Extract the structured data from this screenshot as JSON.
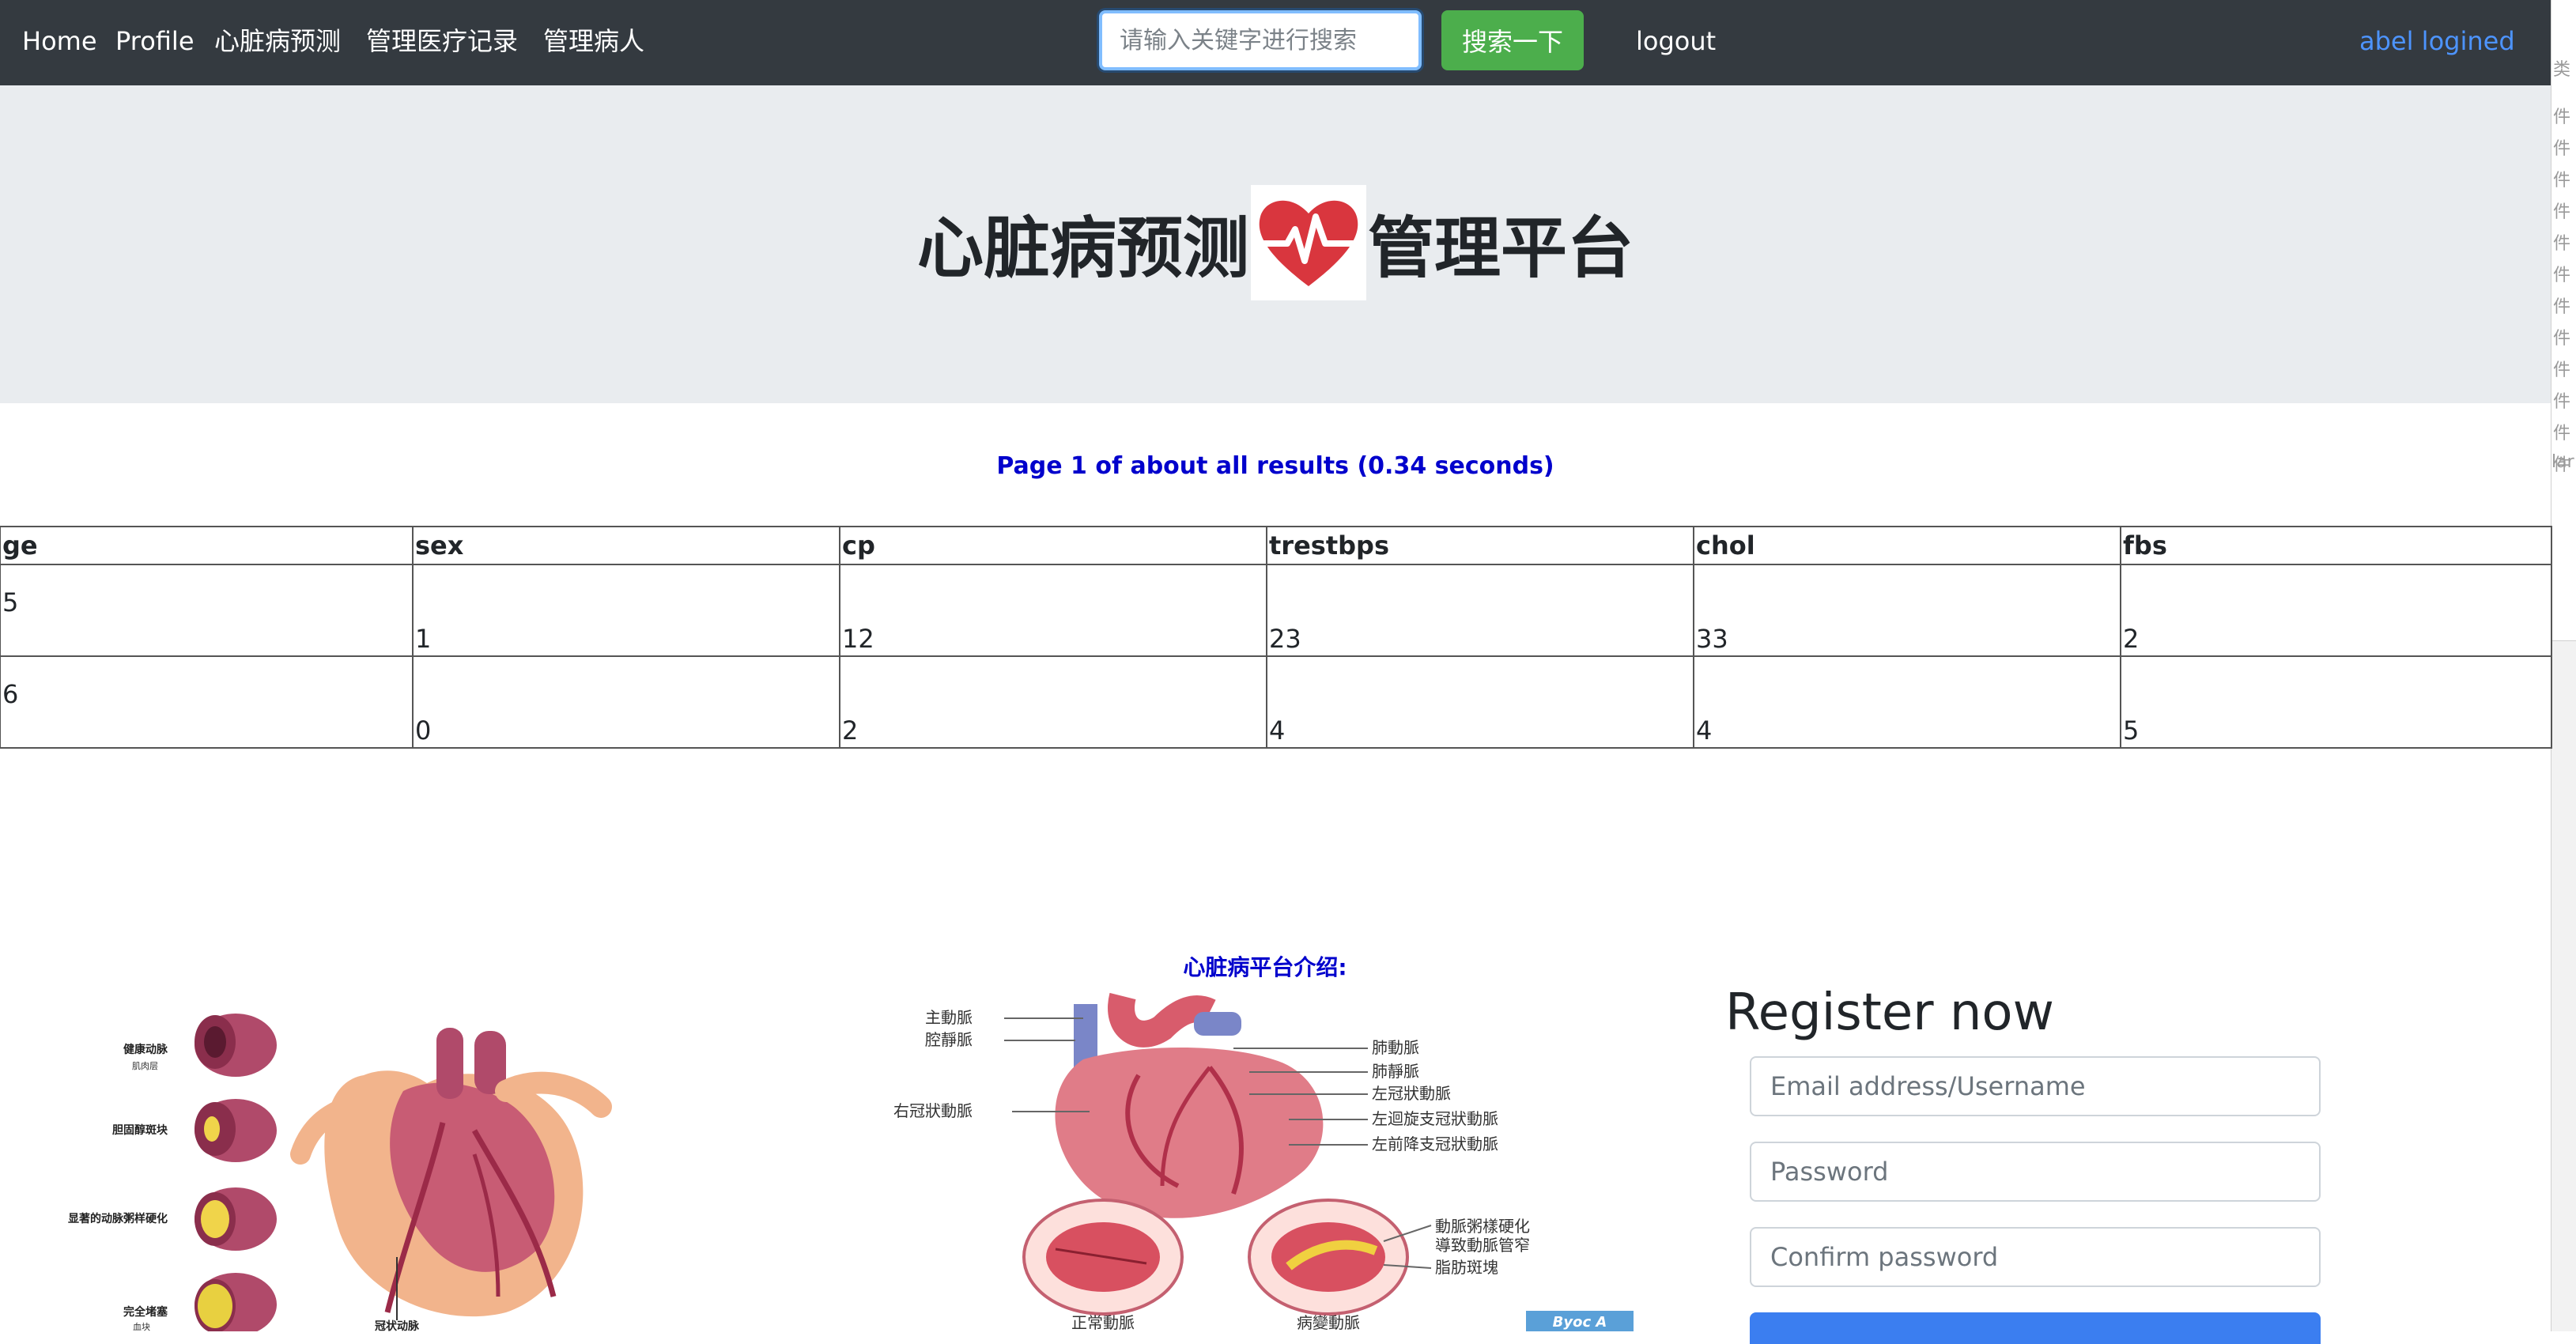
{
  "navbar": {
    "home": "Home",
    "profile": "Profile",
    "predict": "心脏病预测",
    "records": "管理医疗记录",
    "patients": "管理病人",
    "search_placeholder": "请输入关键字进行搜索",
    "search_button": "搜索一下",
    "logout": "logout",
    "user_status": "abel logined"
  },
  "side_strip": {
    "snippets": [
      "类",
      "件",
      "件",
      "件",
      "件",
      "件",
      "件",
      "件",
      "件",
      "件",
      "件",
      "件",
      "件",
      "lar"
    ]
  },
  "hero": {
    "title_left": "心脏病预测",
    "title_right": "管理平台"
  },
  "results": {
    "info": "Page 1 of about all results (0.34 seconds)"
  },
  "table": {
    "headers": [
      "ge",
      "sex",
      "cp",
      "trestbps",
      "chol",
      "fbs"
    ],
    "rows": [
      [
        "5",
        "1",
        "12",
        "23",
        "33",
        "2"
      ],
      [
        "6",
        "0",
        "2",
        "4",
        "4",
        "5"
      ]
    ]
  },
  "left_diagram": {
    "labels": [
      "健康动脉",
      "肌肉层",
      "胆固醇斑块",
      "显著的动脉粥样硬化",
      "完全堵塞",
      "血块",
      "冠状动脉"
    ]
  },
  "intro": {
    "title": "心脏病平台介绍:",
    "labels_left": [
      "主動脈",
      "腔靜脈",
      "右冠狀動脈"
    ],
    "labels_right": [
      "肺動脈",
      "肺靜脈",
      "左冠狀動脈",
      "左迴旋支冠狀動脈",
      "左前降支冠狀動脈",
      "動脈粥樣硬化",
      "導致動脈管窄",
      "脂肪斑塊"
    ],
    "labels_bottom": [
      "正常動脈",
      "病變動脈"
    ],
    "badge": "Byoc A"
  },
  "register": {
    "title": "Register now",
    "email_placeholder": "Email address/Username",
    "password_placeholder": "Password",
    "confirm_placeholder": "Confirm password"
  },
  "colors": {
    "navbar_bg": "#343a40",
    "jumbotron_bg": "#e9ecef",
    "search_button": "#4cae4c",
    "user_link": "#4d94ff",
    "info_text": "#0000cc",
    "heart": "#d9363e",
    "submit_button": "#3b7ef0"
  }
}
